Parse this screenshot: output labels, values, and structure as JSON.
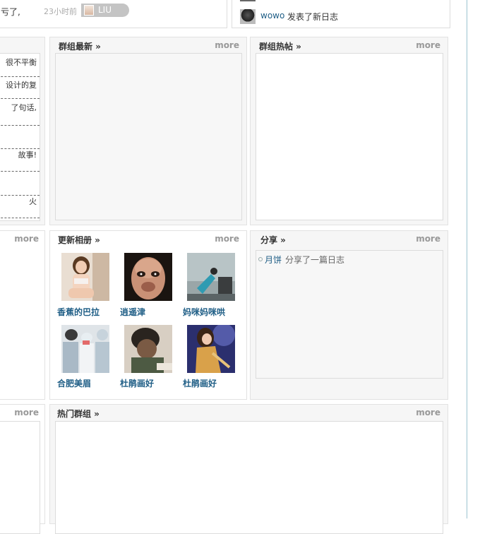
{
  "top_left": {
    "text": "亏了,"
  },
  "activity": {
    "time": "23小时前",
    "user": "LIU"
  },
  "feed": {
    "user": "wowo",
    "action": "发表了新日志"
  },
  "left_col": {
    "lines": [
      "很不平衡",
      "设计的复",
      "了句话,",
      "故事!",
      "火"
    ],
    "more2": "more",
    "more3": "more"
  },
  "group_latest": {
    "title": "群组最新 »",
    "more": "more"
  },
  "group_hot_posts": {
    "title": "群组热帖 »",
    "more": "more"
  },
  "albums": {
    "title": "更新相册 »",
    "more": "more",
    "items": [
      {
        "caption": "香蕉的巴拉"
      },
      {
        "caption": "逍遥津"
      },
      {
        "caption": "妈咪妈咪哄"
      },
      {
        "caption": "合肥美眉"
      },
      {
        "caption": "杜鹃画好"
      },
      {
        "caption": "杜鹃画好"
      }
    ]
  },
  "share": {
    "title": "分享 »",
    "more": "more",
    "user": "月饼",
    "action": "分享了一篇日志"
  },
  "hot_groups": {
    "title": "热门群组 »",
    "more": "more"
  }
}
